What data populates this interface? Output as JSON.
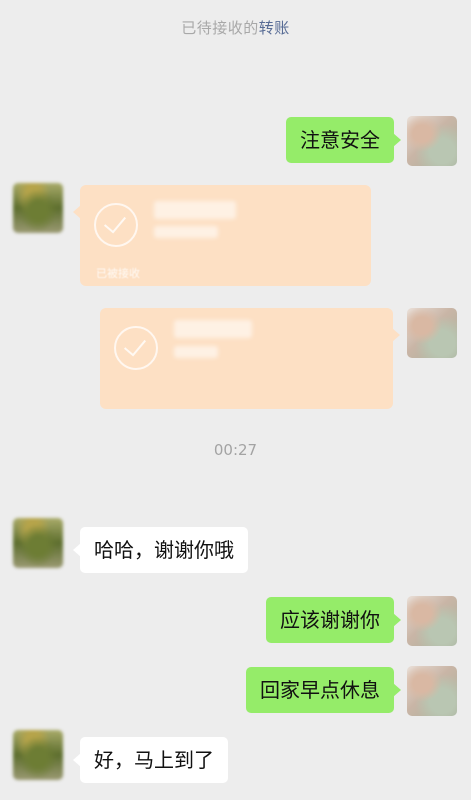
{
  "notice": {
    "prefix": "已待接收的",
    "link": "转账"
  },
  "timestamp": "00:27",
  "messages": {
    "m1": "注意安全",
    "m2": "哈哈，谢谢你哦",
    "m3": "应该谢谢你",
    "m4": "回家早点休息",
    "m5": "好，马上到了"
  },
  "transfers": {
    "t1": {
      "footer": "已被接收"
    },
    "t2": {}
  },
  "colors": {
    "background": "#ededed",
    "sent_bubble": "#95ec69",
    "received_bubble": "#ffffff",
    "transfer_card": "#fde0c4",
    "link": "#576b95"
  }
}
